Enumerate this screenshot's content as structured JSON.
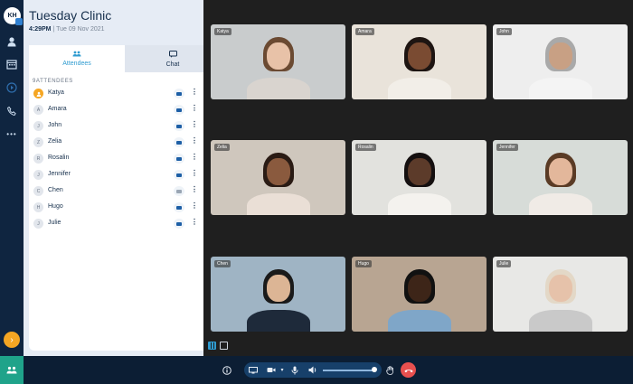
{
  "app": {
    "title": "Tuesday Clinic",
    "time": "4:29PM",
    "date": "Tue 09 Nov 2021"
  },
  "user": {
    "initials": "KH"
  },
  "tabs": [
    {
      "label": "Attendees",
      "icon": "people-icon",
      "active": true
    },
    {
      "label": "Chat",
      "icon": "chat-icon",
      "active": false
    }
  ],
  "attendee_count_label": "9ATTENDEES",
  "attendees": [
    {
      "initial": "",
      "name": "Katya",
      "host": true,
      "camera_on": true
    },
    {
      "initial": "A",
      "name": "Amara",
      "host": false,
      "camera_on": true
    },
    {
      "initial": "J",
      "name": "John",
      "host": false,
      "camera_on": true
    },
    {
      "initial": "Z",
      "name": "Zelia",
      "host": false,
      "camera_on": true
    },
    {
      "initial": "R",
      "name": "Rosalin",
      "host": false,
      "camera_on": true
    },
    {
      "initial": "J",
      "name": "Jennifer",
      "host": false,
      "camera_on": true
    },
    {
      "initial": "C",
      "name": "Chen",
      "host": false,
      "camera_on": false
    },
    {
      "initial": "H",
      "name": "Hugo",
      "host": false,
      "camera_on": true
    },
    {
      "initial": "J",
      "name": "Julie",
      "host": false,
      "camera_on": true
    }
  ],
  "tiles": [
    {
      "name": "Katya",
      "bg": "#c9cccd",
      "skin": "#e8c2a8",
      "hair": "#6b4a32",
      "shirt": "#d9d4cf"
    },
    {
      "name": "Amara",
      "bg": "#e9e3da",
      "skin": "#7a4b32",
      "hair": "#1e1512",
      "shirt": "#f2eee8"
    },
    {
      "name": "John",
      "bg": "#eeeeee",
      "skin": "#c8a084",
      "hair": "#a9a9a9",
      "shirt": "#f4f4f4"
    },
    {
      "name": "Zelia",
      "bg": "#cfc7bd",
      "skin": "#8a5a3e",
      "hair": "#2a1b14",
      "shirt": "#eadfd6"
    },
    {
      "name": "Rosalin",
      "bg": "#e2e2de",
      "skin": "#5c3b2a",
      "hair": "#151010",
      "shirt": "#f4f2ee"
    },
    {
      "name": "Jennifer",
      "bg": "#d7dcd8",
      "skin": "#e3b79b",
      "hair": "#5a3b25",
      "shirt": "#f0ebe6"
    },
    {
      "name": "Chen",
      "bg": "#9fb4c4",
      "skin": "#dcb595",
      "hair": "#1a1a1a",
      "shirt": "#1e2a3a"
    },
    {
      "name": "Hugo",
      "bg": "#b8a592",
      "skin": "#3d2518",
      "hair": "#111111",
      "shirt": "#7fa6c8"
    },
    {
      "name": "Julie",
      "bg": "#e8e8e6",
      "skin": "#e6c2aa",
      "hair": "#e3d8c7",
      "shirt": "#c9c9c9"
    }
  ],
  "rail_icons": [
    "contact-icon",
    "calendar-icon",
    "play-icon",
    "phone-icon",
    "more-icon"
  ],
  "controls": {
    "volume_level": 1.0
  }
}
